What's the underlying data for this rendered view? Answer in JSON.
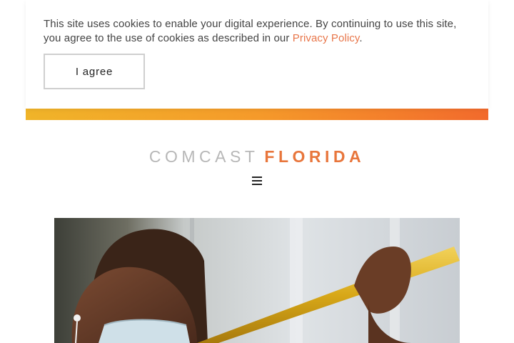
{
  "cookie_banner": {
    "message": "This site uses cookies to enable your digital experience. By continuing to use this site, you agree to the use of cookies as described in our ",
    "privacy_link": "Privacy Policy",
    "period": ".",
    "agree_label": "I agree"
  },
  "brand": {
    "light": "COMCAST",
    "accent": "FLORIDA"
  },
  "colors": {
    "accent": "#e8763c",
    "link": "#e8764a",
    "gradient_start": "#f0b429",
    "gradient_end": "#f26a2c"
  },
  "icons": {
    "menu": "hamburger-menu-icon"
  }
}
